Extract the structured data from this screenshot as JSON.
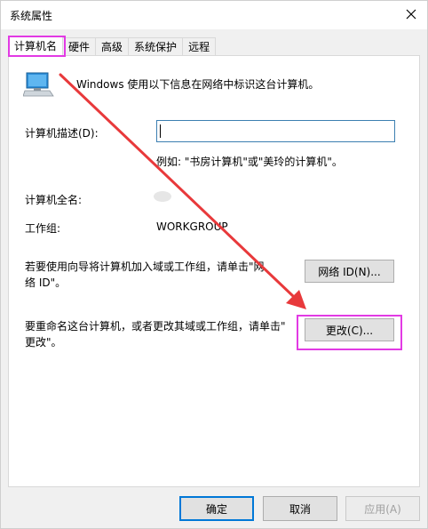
{
  "window": {
    "title": "系统属性",
    "close_icon": "close-icon"
  },
  "tabs": [
    {
      "label": "计算机名",
      "active": true
    },
    {
      "label": "硬件",
      "active": false
    },
    {
      "label": "高级",
      "active": false
    },
    {
      "label": "系统保护",
      "active": false
    },
    {
      "label": "远程",
      "active": false
    }
  ],
  "computer_name": {
    "intro": "Windows 使用以下信息在网络中标识这台计算机。",
    "description_label": "计算机描述(D):",
    "description_value": "",
    "example": "例如: \"书房计算机\"或\"美玲的计算机\"。",
    "full_name_label": "计算机全名:",
    "workgroup_label": "工作组:",
    "workgroup_value": "WORKGROUP",
    "network_id_text": "若要使用向导将计算机加入域或工作组，请单击\"网络 ID\"。",
    "network_id_text_line1": "若要使用向导将计算机加入域或工作组，请单击\"网",
    "network_id_text_line2": "络 ID\"。",
    "network_id_button": "网络 ID(N)...",
    "rename_text_line1": "要重命名这台计算机，或者更改其域或工作组，请单击\"",
    "rename_text_line2": "更改\"。",
    "change_button": "更改(C)..."
  },
  "footer": {
    "ok": "确定",
    "cancel": "取消",
    "apply": "应用(A)"
  },
  "colors": {
    "highlight": "#e23ae4",
    "arrow": "#e8393b",
    "focus_border": "#0078d7"
  }
}
